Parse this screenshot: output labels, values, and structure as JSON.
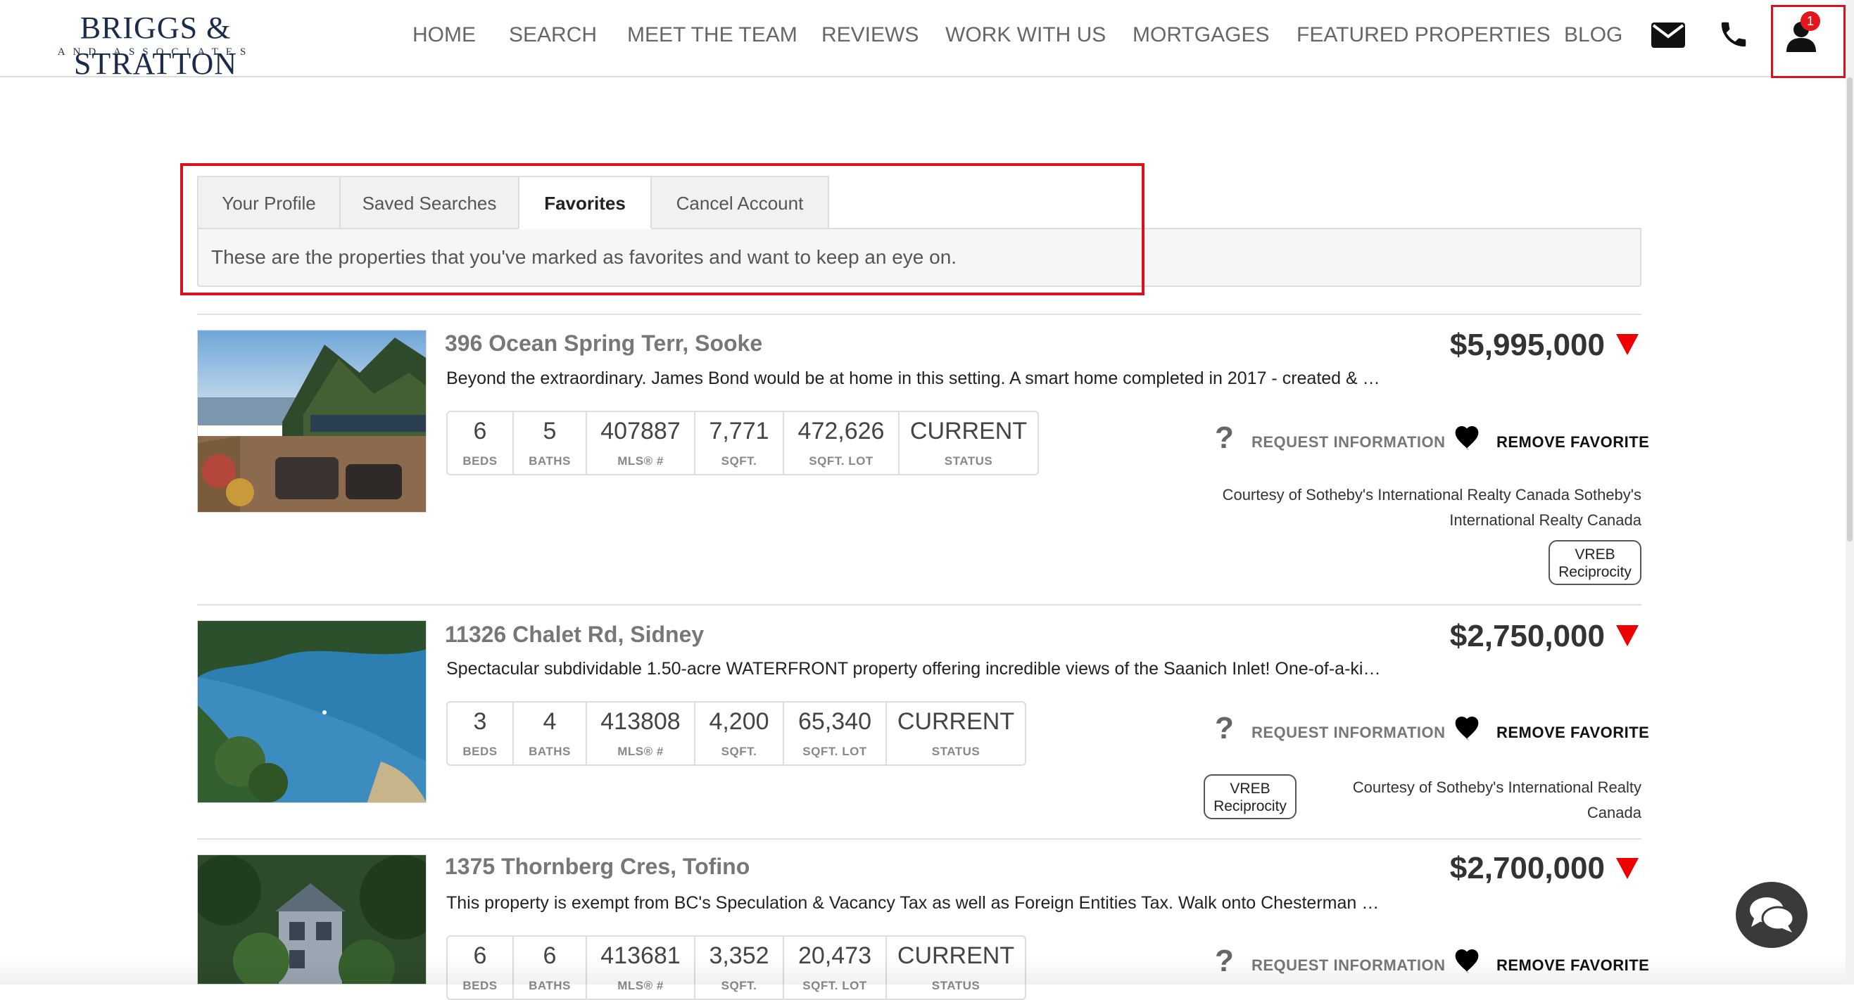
{
  "brand": {
    "name": "BRIGGS & STRATTON",
    "sub": "AND ASSOCIATES"
  },
  "nav": {
    "items": [
      "HOME",
      "SEARCH",
      "MEET THE TEAM",
      "REVIEWS",
      "WORK WITH US",
      "MORTGAGES",
      "FEATURED PROPERTIES",
      "BLOG"
    ],
    "icons": [
      "envelope-icon",
      "phone-icon",
      "user-icon"
    ],
    "notification_count": "1"
  },
  "tabs": {
    "items": [
      "Your Profile",
      "Saved Searches",
      "Favorites",
      "Cancel Account"
    ],
    "active": "Favorites",
    "description": "These are the properties that you've marked as favorites and want to keep an eye on."
  },
  "stat_labels": [
    "BEDS",
    "BATHS",
    "MLS® #",
    "SQFT.",
    "SQFT. LOT",
    "STATUS"
  ],
  "actions": {
    "request": "REQUEST INFORMATION",
    "remove": "REMOVE FAVORITE"
  },
  "listings": [
    {
      "address": "396 Ocean Spring Terr, Sooke",
      "description": "Beyond the extraordinary. James Bond would be at home in this setting. A smart home completed in 2017 - created & …",
      "price": "$5,995,000",
      "beds": "6",
      "baths": "5",
      "mls": "407887",
      "sqft": "7,771",
      "lot": "472,626",
      "status": "CURRENT",
      "courtesy_line1": "Courtesy of Sotheby's International Realty Canada Sotheby's",
      "courtesy_line2": "International Realty Canada",
      "vreb": [
        "VREB",
        "Reciprocity"
      ]
    },
    {
      "address": "11326 Chalet Rd, Sidney",
      "description": "Spectacular subdividable 1.50-acre WATERFRONT property offering incredible views of the Saanich Inlet! One-of-a-ki…",
      "price": "$2,750,000",
      "beds": "3",
      "baths": "4",
      "mls": "413808",
      "sqft": "4,200",
      "lot": "65,340",
      "status": "CURRENT",
      "courtesy_line1": "Courtesy of Sotheby's International Realty Canada",
      "vreb": [
        "VREB",
        "Reciprocity"
      ]
    },
    {
      "address": "1375 Thornberg Cres, Tofino",
      "description": "This property is exempt from BC's Speculation & Vacancy Tax as well as Foreign Entities Tax. Walk onto Chesterman …",
      "price": "$2,700,000",
      "beds": "6",
      "baths": "6",
      "mls": "413681",
      "sqft": "3,352",
      "lot": "20,473",
      "status": "CURRENT"
    }
  ],
  "colors": {
    "accent_red": "#ee0000",
    "highlight_box": "#d9121d",
    "brand_navy": "#1b2b4a"
  }
}
